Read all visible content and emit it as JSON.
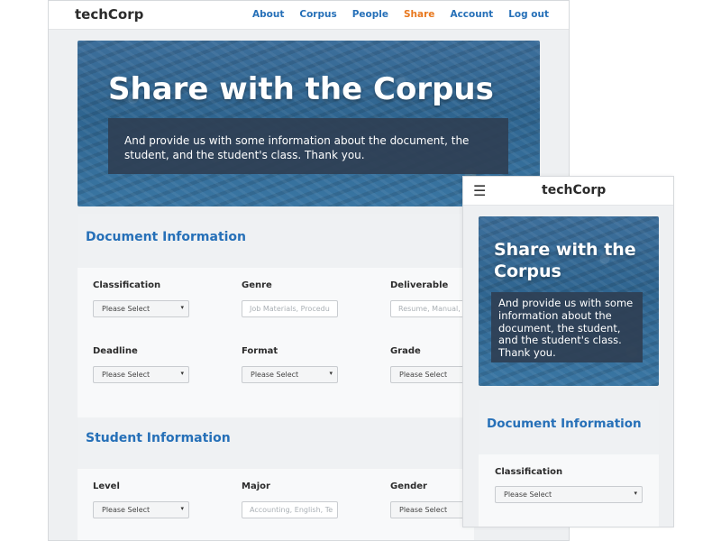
{
  "desktop": {
    "brand": "techCorp",
    "nav": [
      {
        "label": "About",
        "active": false
      },
      {
        "label": "Corpus",
        "active": false
      },
      {
        "label": "People",
        "active": false
      },
      {
        "label": "Share",
        "active": true
      },
      {
        "label": "Account",
        "active": false
      },
      {
        "label": "Log out",
        "active": false
      }
    ],
    "hero": {
      "title": "Share with the Corpus",
      "subtitle": "And provide us with some information about the document, the student, and the student's class. Thank you."
    },
    "document_section": {
      "title": "Document Information",
      "fields": [
        {
          "label": "Classification",
          "type": "select",
          "value": "Please Select"
        },
        {
          "label": "Genre",
          "type": "text",
          "placeholder": "Job Materials, Procedu"
        },
        {
          "label": "Deliverable",
          "type": "text",
          "placeholder": "Resume, Manual, F"
        },
        {
          "label": "Deadline",
          "type": "select",
          "value": "Please Select"
        },
        {
          "label": "Format",
          "type": "select",
          "value": "Please Select"
        },
        {
          "label": "Grade",
          "type": "select",
          "value": "Please Select"
        }
      ]
    },
    "student_section": {
      "title": "Student Information",
      "fields": [
        {
          "label": "Level",
          "type": "select",
          "value": "Please Select"
        },
        {
          "label": "Major",
          "type": "text",
          "placeholder": "Accounting, English, Te"
        },
        {
          "label": "Gender",
          "type": "select",
          "value": "Please Select"
        }
      ]
    }
  },
  "mobile": {
    "brand": "techCorp",
    "menu_icon": "hamburger-icon",
    "hero": {
      "title": "Share with the Corpus",
      "subtitle": "And provide us with some information about the document, the student, and the student's class. Thank you."
    },
    "document_section": {
      "title": "Document Information",
      "field": {
        "label": "Classification",
        "type": "select",
        "value": "Please Select"
      }
    }
  },
  "colors": {
    "accent_blue": "#2670b8",
    "active_orange": "#e8781e",
    "hero_overlay": "#2f3f54"
  }
}
